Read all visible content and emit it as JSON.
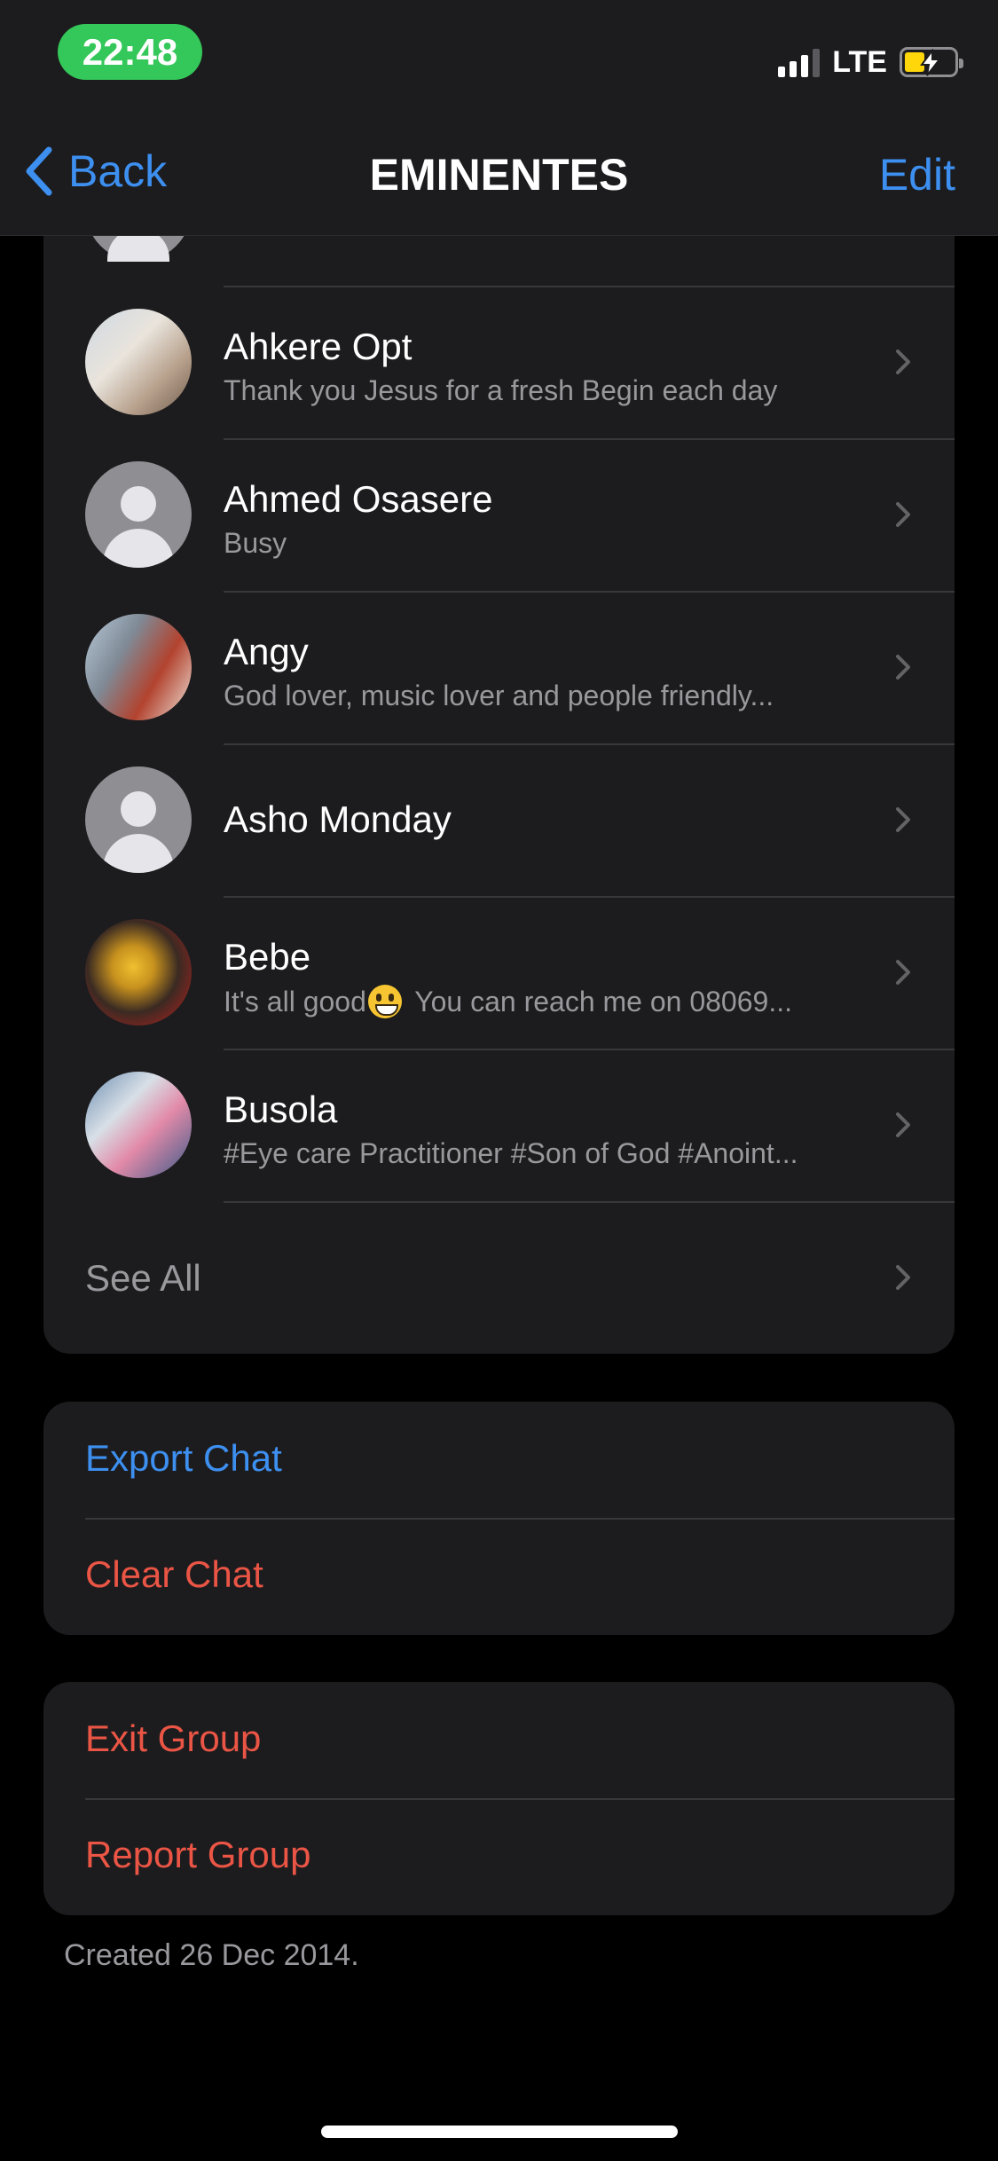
{
  "status_bar": {
    "time": "22:48",
    "network": "LTE"
  },
  "nav": {
    "back_label": "Back",
    "title": "EMINENTES",
    "edit_label": "Edit"
  },
  "members": [
    {
      "name": "Ahkere Opt",
      "status": "Thank you Jesus for a fresh Begin each day",
      "avatar": "photo"
    },
    {
      "name": "Ahmed Osasere",
      "status": "Busy",
      "avatar": "placeholder"
    },
    {
      "name": "Angy",
      "status": "God lover, music lover and people friendly...",
      "avatar": "photo"
    },
    {
      "name": "Asho Monday",
      "status": "",
      "avatar": "placeholder"
    },
    {
      "name": "Bebe",
      "status_before_emoji": "It's all good",
      "status_after_emoji": " You can reach me on 08069...",
      "avatar": "photo"
    },
    {
      "name": "Busola",
      "status": "#Eye care Practitioner #Son of God #Anoint...",
      "avatar": "photo"
    }
  ],
  "see_all_label": "See All",
  "actions": {
    "export_chat": "Export Chat",
    "clear_chat": "Clear Chat",
    "exit_group": "Exit Group",
    "report_group": "Report Group"
  },
  "footer": {
    "created": "Created 26 Dec 2014."
  },
  "colors": {
    "accent": "#3d8ff0",
    "destructive": "#eb5545",
    "time_pill": "#34c759"
  }
}
